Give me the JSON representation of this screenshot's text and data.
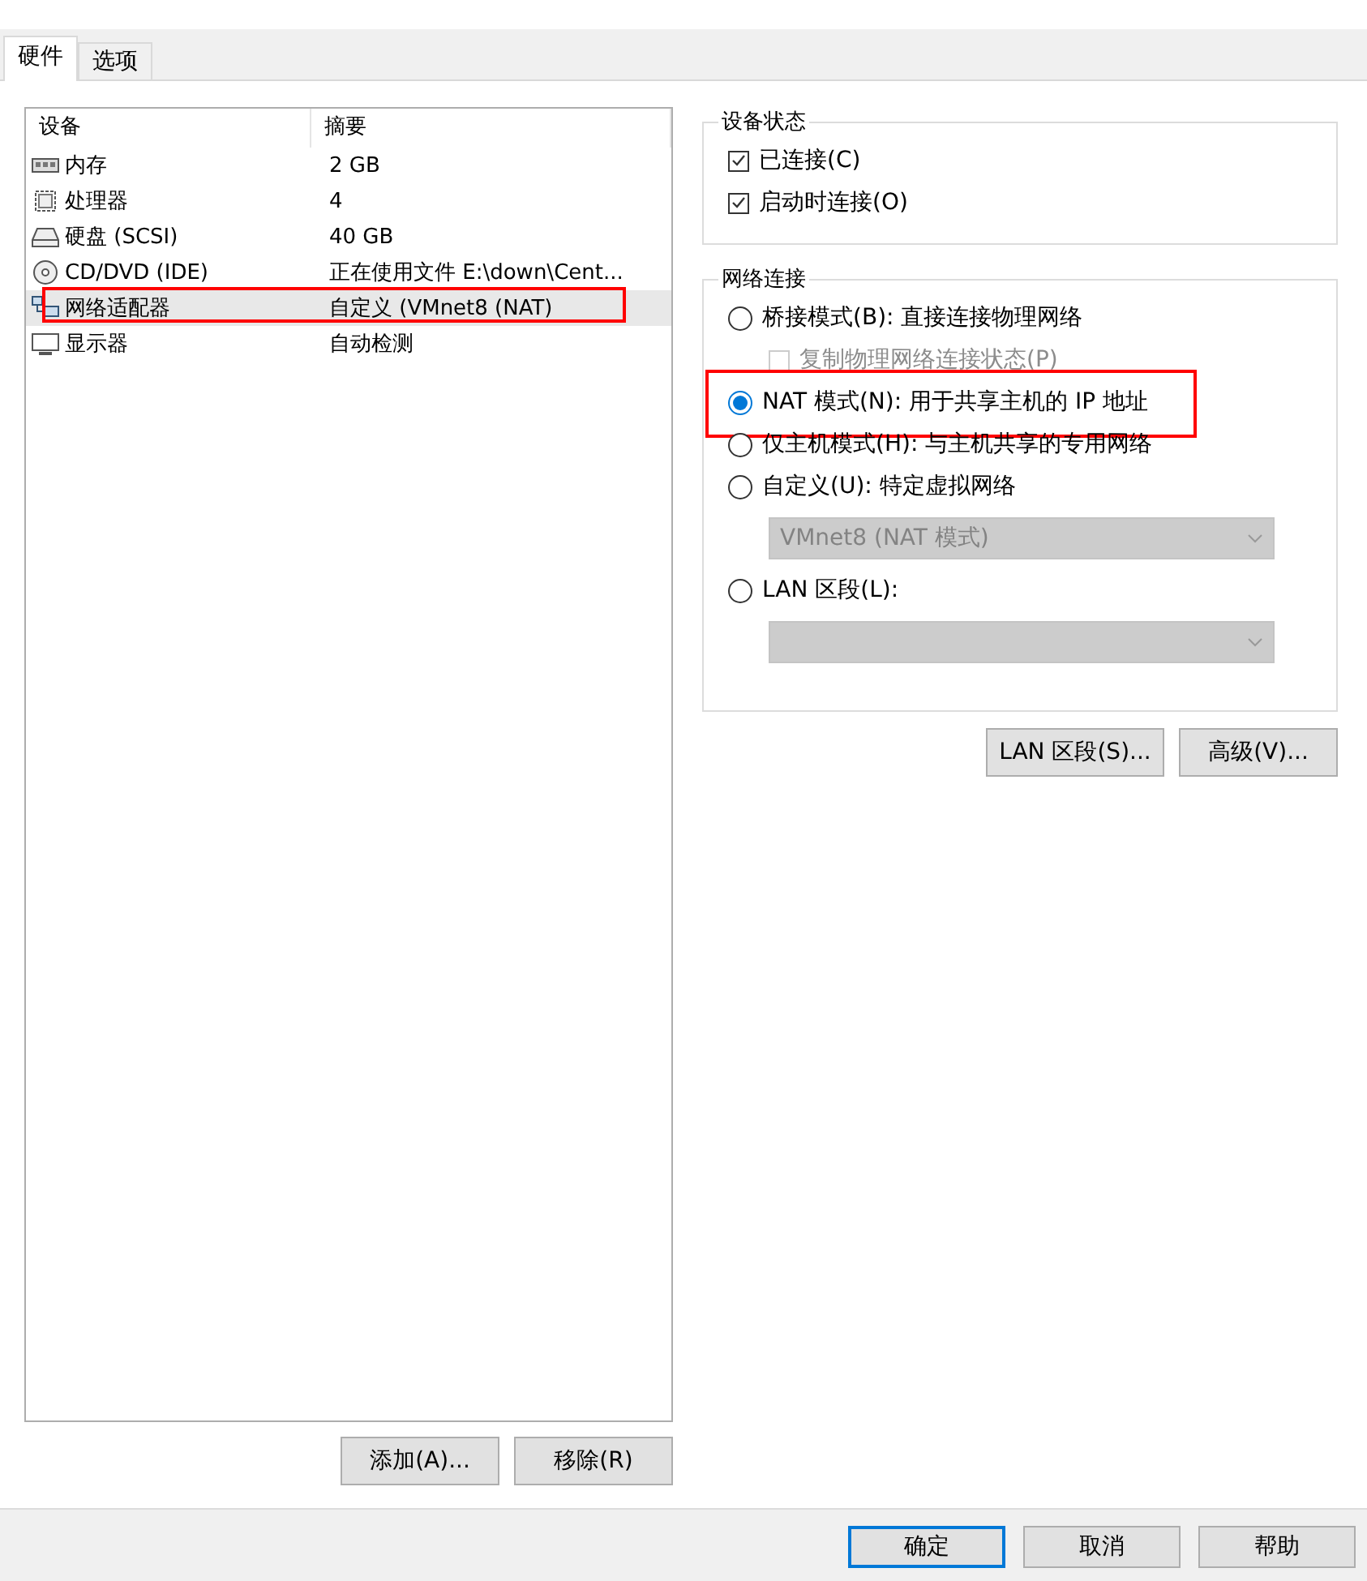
{
  "tabs": [
    {
      "label": "硬件",
      "selected": true
    },
    {
      "label": "选项",
      "selected": false
    }
  ],
  "device_table": {
    "columns": [
      "设备",
      "摘要"
    ],
    "rows": [
      {
        "kind": "memory",
        "device": "内存",
        "summary": "2 GB",
        "selected": false,
        "highlighted": false
      },
      {
        "kind": "cpu",
        "device": "处理器",
        "summary": "4",
        "selected": false,
        "highlighted": false
      },
      {
        "kind": "disk",
        "device": "硬盘 (SCSI)",
        "summary": "40 GB",
        "selected": false,
        "highlighted": false
      },
      {
        "kind": "cdrom",
        "device": "CD/DVD (IDE)",
        "summary": "正在使用文件 E:\\down\\Cent...",
        "selected": false,
        "highlighted": false
      },
      {
        "kind": "network",
        "device": "网络适配器",
        "summary": "自定义 (VMnet8 (NAT)",
        "selected": true,
        "highlighted": true
      },
      {
        "kind": "display",
        "device": "显示器",
        "summary": "自动检测",
        "selected": false,
        "highlighted": false
      }
    ]
  },
  "list_buttons": [
    "添加(A)...",
    "移除(R)"
  ],
  "device_status": {
    "title": "设备状态",
    "options": [
      {
        "label": "已连接(C)",
        "checked": true
      },
      {
        "label": "启动时连接(O)",
        "checked": true
      }
    ]
  },
  "network_connection": {
    "title": "网络连接",
    "options": [
      {
        "kind": "radio",
        "label": "桥接模式(B): 直接连接物理网络",
        "selected": false,
        "highlighted": false
      },
      {
        "kind": "checkbox",
        "label": "复制物理网络连接状态(P)",
        "checked": false,
        "disabled": true
      },
      {
        "kind": "radio",
        "label": "NAT 模式(N): 用于共享主机的 IP 地址",
        "selected": true,
        "highlighted": true
      },
      {
        "kind": "radio",
        "label": "仅主机模式(H): 与主机共享的专用网络",
        "selected": false,
        "highlighted": false
      },
      {
        "kind": "radio",
        "label": "自定义(U): 特定虚拟网络",
        "selected": false,
        "highlighted": false
      },
      {
        "kind": "dropdown",
        "value": "VMnet8 (NAT 模式)",
        "disabled": true
      },
      {
        "kind": "radio",
        "label": "LAN 区段(L):",
        "selected": false,
        "highlighted": false
      },
      {
        "kind": "dropdown",
        "disabled": true
      }
    ]
  },
  "network_buttons": [
    "LAN 区段(S)...",
    "高级(V)..."
  ],
  "dialog_buttons": [
    {
      "label": "确定",
      "default": true
    },
    {
      "label": "取消",
      "default": false
    },
    {
      "label": "帮助",
      "default": false
    }
  ]
}
